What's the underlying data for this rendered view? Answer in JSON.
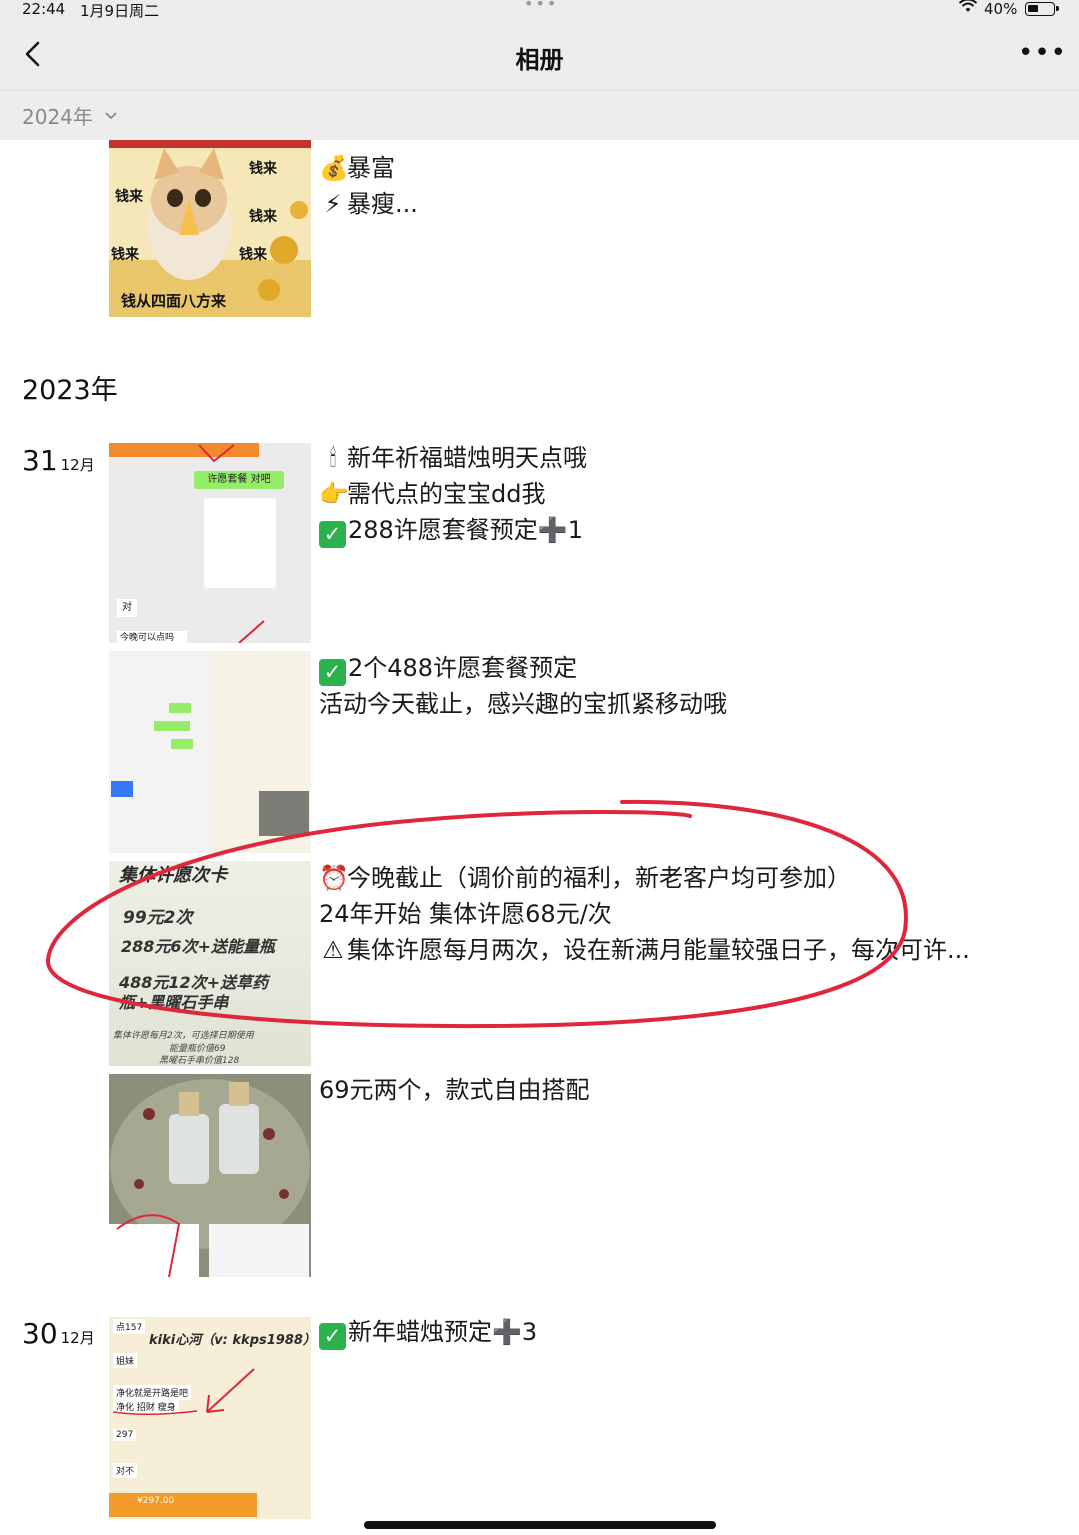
{
  "status": {
    "time": "22:44",
    "date": "1月9日周二",
    "battery": "40%",
    "battery_level": 0.4
  },
  "nav": {
    "title": "相册",
    "year_selector": "2024年"
  },
  "year_heading": "2023年",
  "top_post": {
    "lines": [
      "暴富",
      "暴瘦..."
    ],
    "image_text": {
      "big": "钱来",
      "bottom": "钱从四面八方来"
    }
  },
  "days": [
    {
      "day": "31",
      "month": "12月"
    },
    {
      "day": "30",
      "month": "12月"
    }
  ],
  "posts": [
    {
      "lines": [
        "新年祈福蜡烛明天点哦",
        "需代点的宝宝dd我",
        "288许愿套餐预定➕1"
      ],
      "image_text": {
        "header": "许愿套餐 对吧",
        "chat1": "对",
        "chat2": "今晚可以点吗"
      }
    },
    {
      "lines": [
        "2个488许愿套餐预定",
        "活动今天截止，感兴趣的宝抓紧移动哦"
      ]
    },
    {
      "lines": [
        "今晚截止（调价前的福利，新老客户均可参加）",
        "24年开始 集体许愿68元/次",
        "集体许愿每月两次，设在新满月能量较强日子，每次可许..."
      ],
      "image_text": {
        "title": "集体许愿次卡",
        "l1": "99元2次",
        "l2": "288元6次+送能量瓶",
        "l3": "488元12次+送草药",
        "l4": "瓶+黑曜石手串",
        "note1": "集体许愿每月2次，可选择日期使用",
        "note2": "能量瓶价值69",
        "note3": "黑曜石手串价值128"
      }
    },
    {
      "lines": [
        "69元两个，款式自由搭配"
      ]
    },
    {
      "lines": [
        "新年蜡烛预定➕3"
      ],
      "image_text": {
        "watermark": "kiki心河（v: kkps1988）",
        "c1": "点157",
        "c2": "姐妹",
        "c3": "净化就是开路是吧",
        "c4": "净化 招财 瘦身",
        "c5": "297",
        "c6": "对不",
        "pay": "¥297.00"
      }
    }
  ],
  "colors": {
    "accent_green": "#2bb24c",
    "annotation_red": "#e0263a",
    "nav_bg": "#ededed"
  }
}
